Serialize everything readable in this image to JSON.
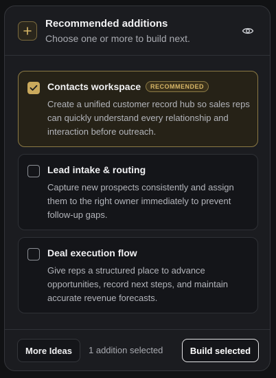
{
  "header": {
    "title": "Recommended additions",
    "subtitle": "Choose one or more to build next.",
    "icon": "plus-icon",
    "action_icon": "eye-icon"
  },
  "options": [
    {
      "title": "Contacts workspace",
      "badge": "RECOMMENDED",
      "description": "Create a unified customer record hub so sales reps can quickly understand every relationship and interaction before outreach.",
      "selected": true
    },
    {
      "title": "Lead intake & routing",
      "description": "Capture new prospects consistently and assign them to the right owner immediately to prevent follow-up gaps.",
      "selected": false
    },
    {
      "title": "Deal execution flow",
      "description": "Give reps a structured place to advance opportunities, record next steps, and maintain accurate revenue forecasts.",
      "selected": false
    }
  ],
  "footer": {
    "more_label": "More Ideas",
    "count_text": "1 addition selected",
    "build_label": "Build selected"
  },
  "colors": {
    "accent": "#caa95c",
    "panel": "#1b1c20",
    "card": "#141519"
  }
}
